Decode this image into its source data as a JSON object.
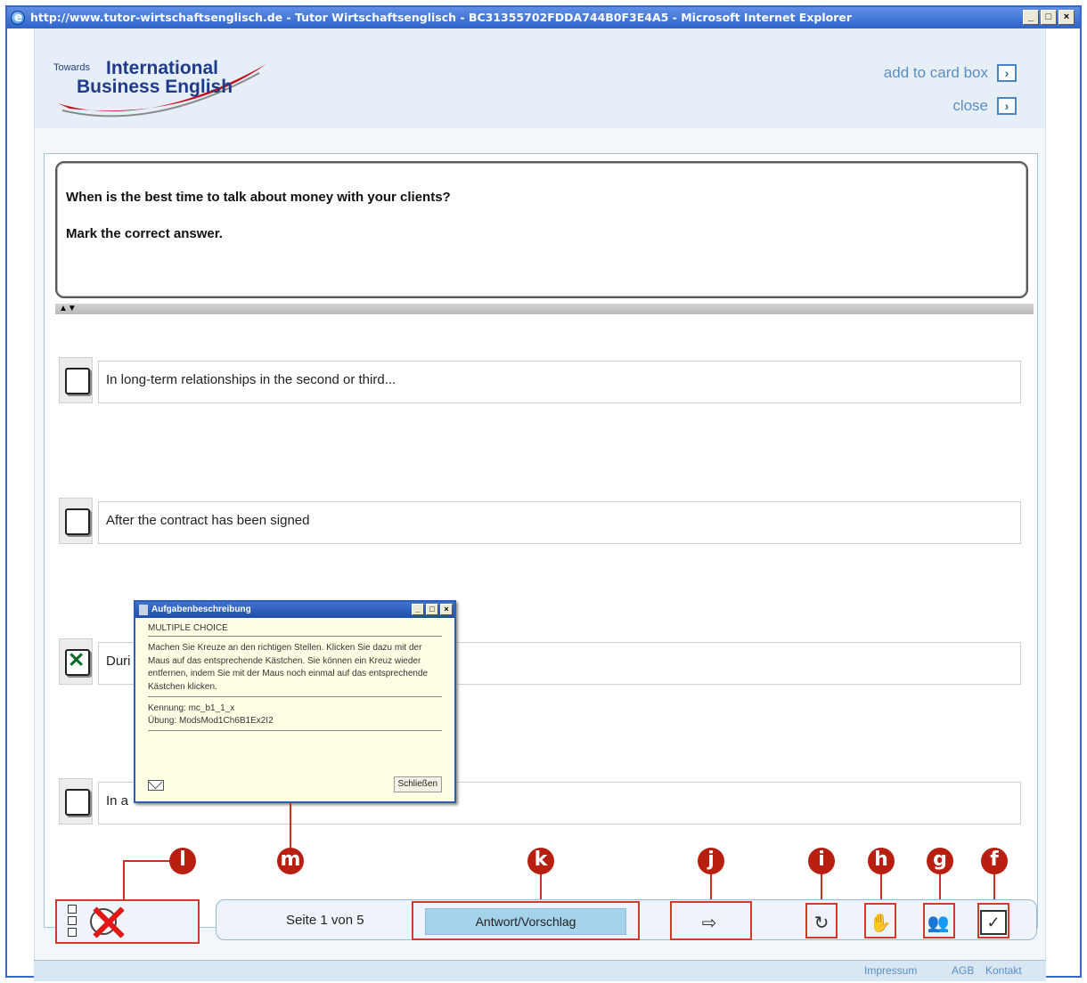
{
  "window": {
    "title": "http://www.tutor-wirtschaftsenglisch.de - Tutor Wirtschaftsenglisch - BC31355702FDDA744B0F3E4A5 - Microsoft Internet Explorer",
    "minimize": "_",
    "maximize": "□",
    "close": "×"
  },
  "header": {
    "logo_towards": "Towards",
    "logo_international": "International",
    "logo_business": "Business English",
    "add_to_card_box": "add to card box",
    "close": "close",
    "arrow": "›"
  },
  "question": {
    "text": "When is the best time to talk about money with your clients?",
    "instruction": "Mark the correct answer."
  },
  "answers": [
    {
      "text": "In long-term relationships in the second or third...",
      "checked": false
    },
    {
      "text": "After the contract has been signed",
      "checked": false
    },
    {
      "text": "Duri",
      "checked": true
    },
    {
      "text": "In a",
      "checked": false
    }
  ],
  "popup": {
    "title": "Aufgabenbeschreibung",
    "heading": "MULTIPLE CHOICE",
    "description": "Machen Sie Kreuze an den richtigen Stellen. Klicken Sie dazu mit der Maus auf das entsprechende Kästchen. Sie können ein Kreuz wieder entfernen, indem Sie mit der Maus noch einmal auf das entsprechende Kästchen klicken.",
    "id_line": "Kennung: mc_b1_1_x",
    "exercise_line": "Übung: ModsMod1Ch6B1Ex2I2",
    "close_button": "Schließen",
    "min": "_",
    "max": "□",
    "x": "×"
  },
  "callouts": [
    "l",
    "m",
    "k",
    "j",
    "i",
    "h",
    "g",
    "f"
  ],
  "toolbar": {
    "page_label": "Seite 1 von 5",
    "answer_button": "Antwort/Vorschlag"
  },
  "footer": {
    "impressum": "Impressum",
    "agb": "AGB",
    "kontakt": "Kontakt"
  },
  "icons": {
    "next": "next-arrow-icon",
    "reset": "reset-icon",
    "audio": "speaker-hand-icon",
    "people": "people-icon",
    "check": "check-icon",
    "uncheck": "uncheck-icon"
  },
  "colors": {
    "accent": "#b81f11",
    "titlebar": "#2e63c8",
    "answer_button": "#a5d3ec"
  }
}
